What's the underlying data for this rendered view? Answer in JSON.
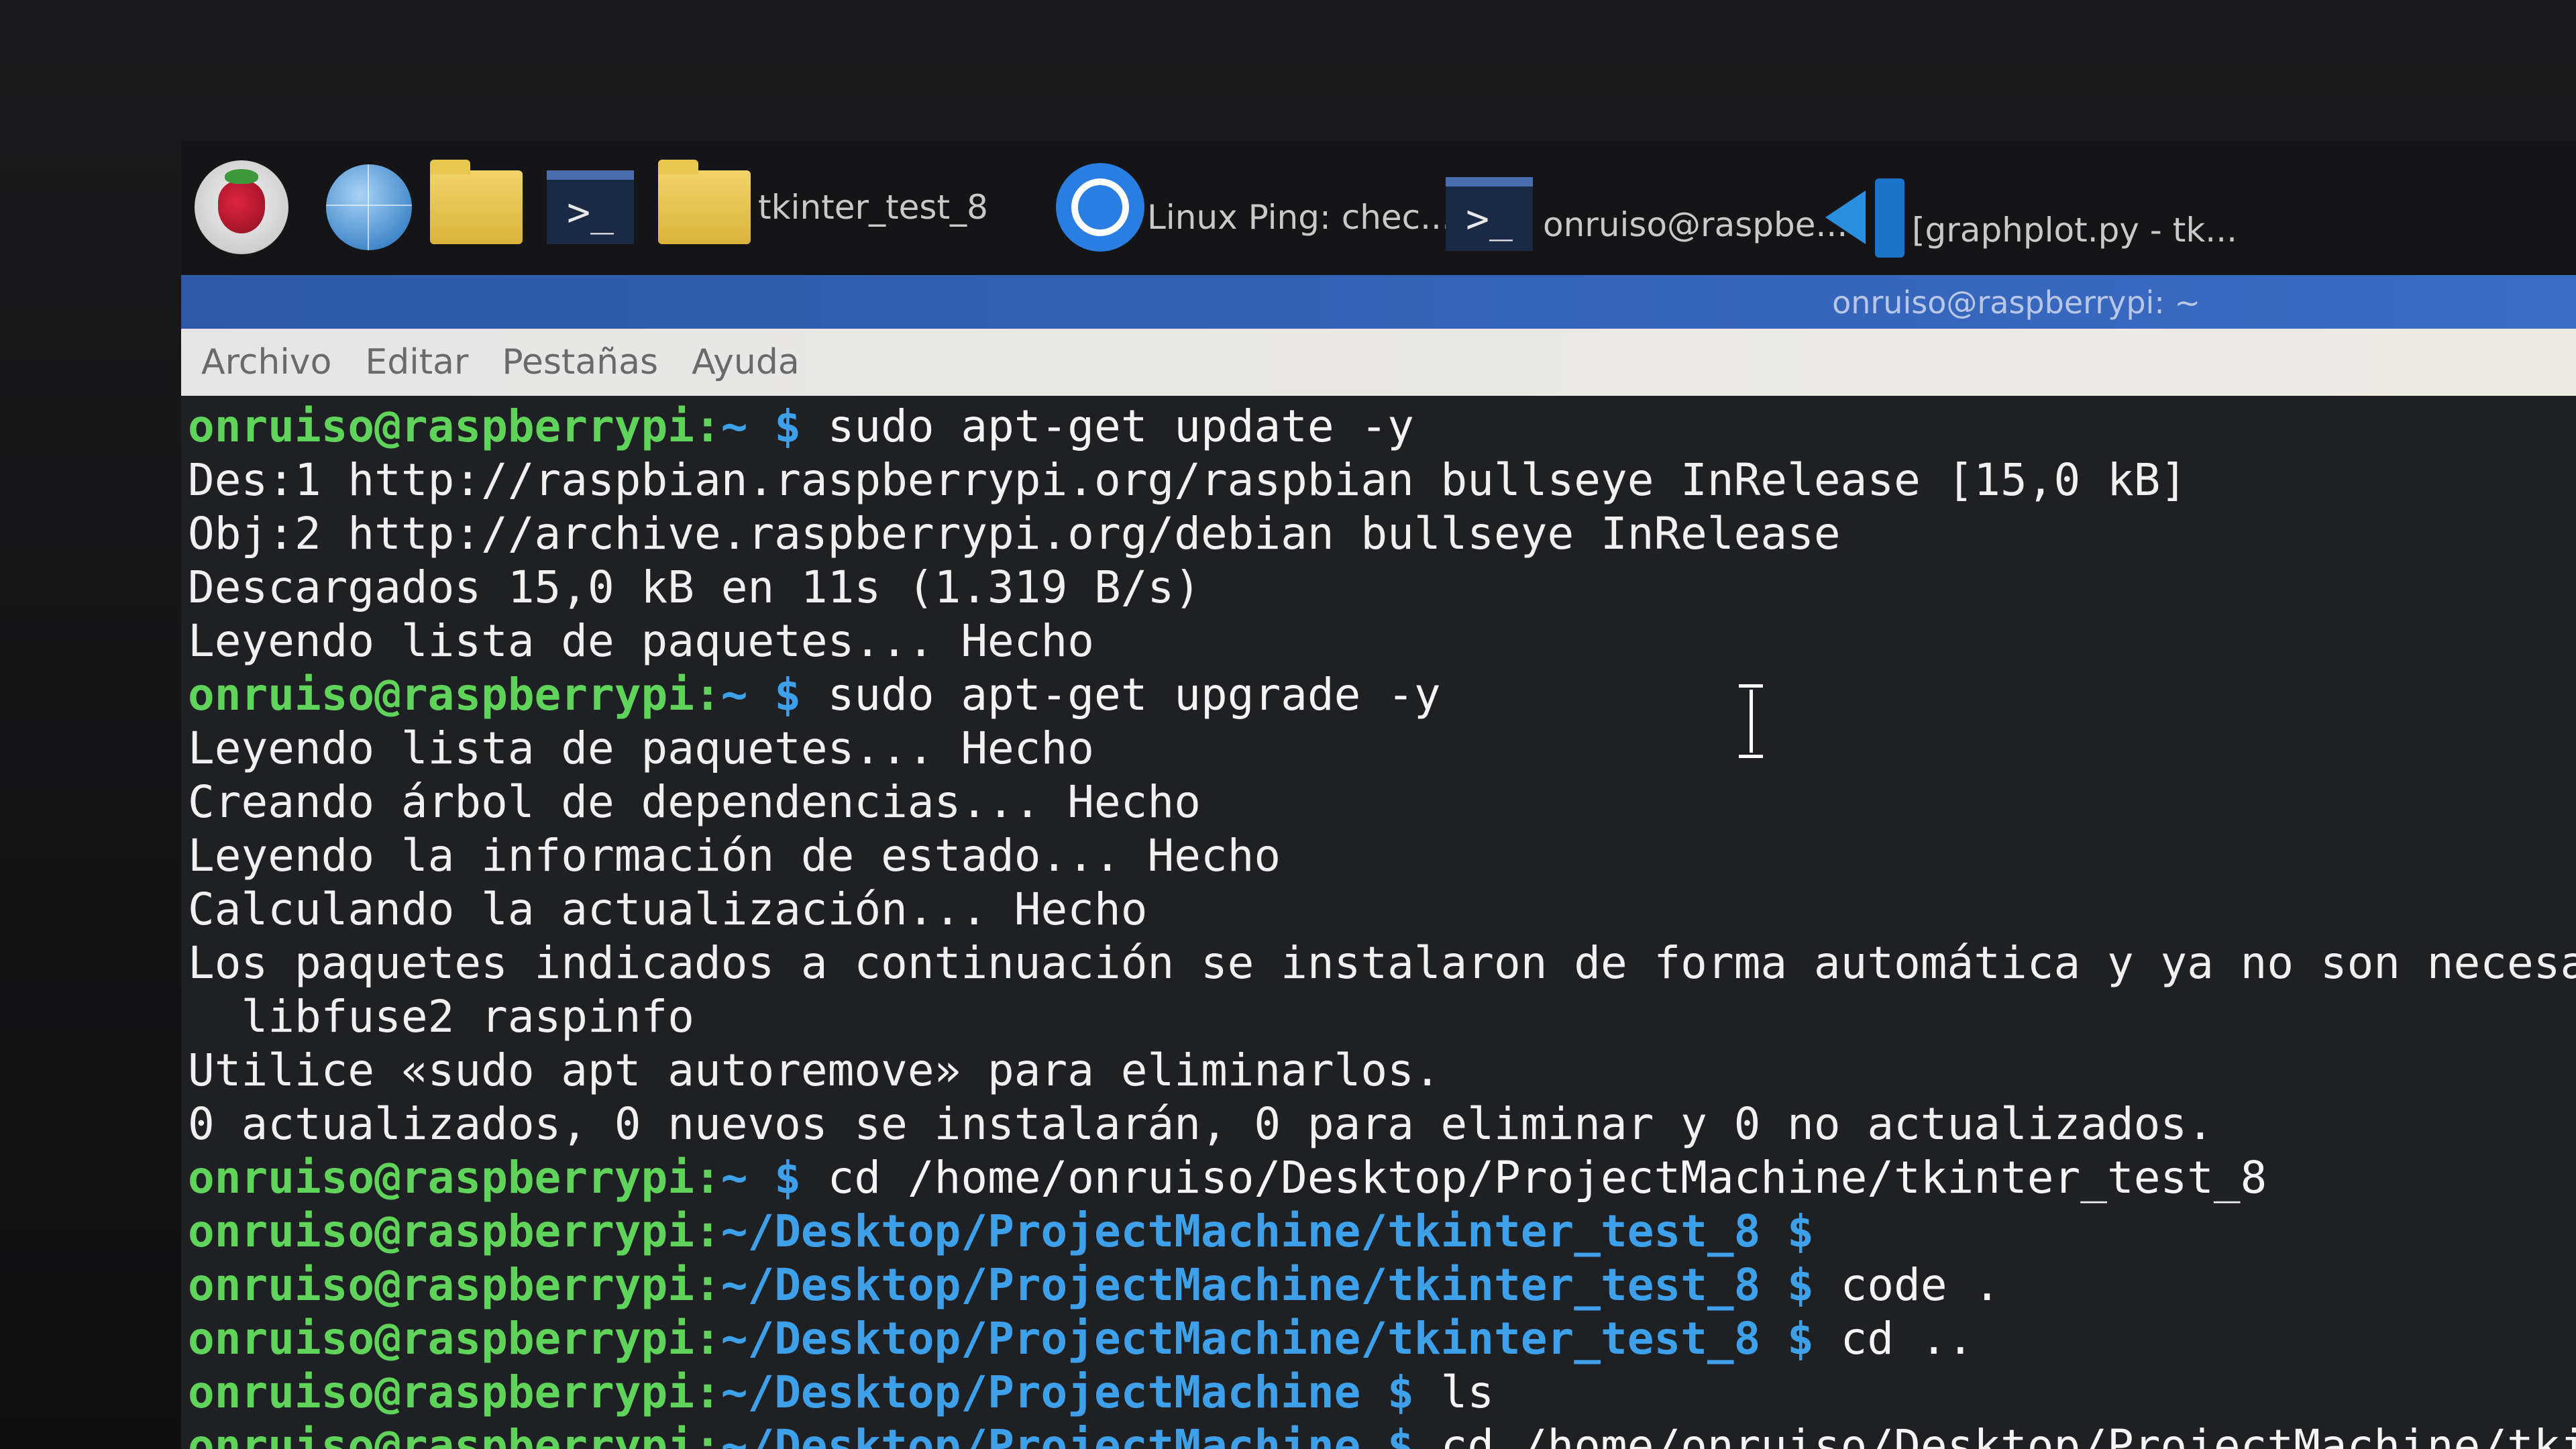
{
  "taskbar": {
    "items": [
      {
        "name": "raspberry-menu",
        "icon": "raspberry-pi-icon"
      },
      {
        "name": "browser",
        "icon": "globe-icon"
      },
      {
        "name": "file-manager",
        "icon": "folder-icon"
      },
      {
        "name": "terminal-launcher",
        "icon": "terminal-icon"
      }
    ],
    "windows": [
      {
        "label": "tkinter_test_8",
        "icon": "folder-icon"
      },
      {
        "label": "Linux Ping: chec...",
        "icon": "chromium-icon"
      },
      {
        "label": "onruiso@raspbe...",
        "icon": "terminal-icon"
      },
      {
        "label": "[graphplot.py - tk...",
        "icon": "vscode-icon"
      }
    ]
  },
  "window": {
    "title": "onruiso@raspberrypi: ~"
  },
  "menu": {
    "archivo": "Archivo",
    "editar": "Editar",
    "pestanas": "Pestañas",
    "ayuda": "Ayuda"
  },
  "terminal": {
    "lines": [
      {
        "user": "onruiso@raspberrypi:",
        "path": "~ $",
        "cmd": " sudo apt-get update -y"
      },
      {
        "out": "Des:1 http://raspbian.raspberrypi.org/raspbian bullseye InRelease [15,0 kB]"
      },
      {
        "out": "Obj:2 http://archive.raspberrypi.org/debian bullseye InRelease"
      },
      {
        "out": "Descargados 15,0 kB en 11s (1.319 B/s)"
      },
      {
        "out": "Leyendo lista de paquetes... Hecho"
      },
      {
        "user": "onruiso@raspberrypi:",
        "path": "~ $",
        "cmd": " sudo apt-get upgrade -y"
      },
      {
        "out": "Leyendo lista de paquetes... Hecho"
      },
      {
        "out": "Creando árbol de dependencias... Hecho"
      },
      {
        "out": "Leyendo la información de estado... Hecho"
      },
      {
        "out": "Calculando la actualización... Hecho"
      },
      {
        "out": "Los paquetes indicados a continuación se instalaron de forma automática y ya no son necesar"
      },
      {
        "out": "  libfuse2 raspinfo"
      },
      {
        "out": "Utilice «sudo apt autoremove» para eliminarlos."
      },
      {
        "out": "0 actualizados, 0 nuevos se instalarán, 0 para eliminar y 0 no actualizados."
      },
      {
        "user": "onruiso@raspberrypi:",
        "path": "~ $",
        "cmd": " cd /home/onruiso/Desktop/ProjectMachine/tkinter_test_8"
      },
      {
        "user": "onruiso@raspberrypi:",
        "path": "~/Desktop/ProjectMachine/tkinter_test_8 $",
        "cmd": ""
      },
      {
        "user": "onruiso@raspberrypi:",
        "path": "~/Desktop/ProjectMachine/tkinter_test_8 $",
        "cmd": " code ."
      },
      {
        "user": "onruiso@raspberrypi:",
        "path": "~/Desktop/ProjectMachine/tkinter_test_8 $",
        "cmd": " cd .."
      },
      {
        "user": "onruiso@raspberrypi:",
        "path": "~/Desktop/ProjectMachine $",
        "cmd": " ls"
      },
      {
        "user": "onruiso@raspberrypi:",
        "path": "~/Desktop/ProjectMachine $",
        "cmd": " cd /home/onruiso/Desktop/ProjectMachine/tkint"
      }
    ]
  }
}
